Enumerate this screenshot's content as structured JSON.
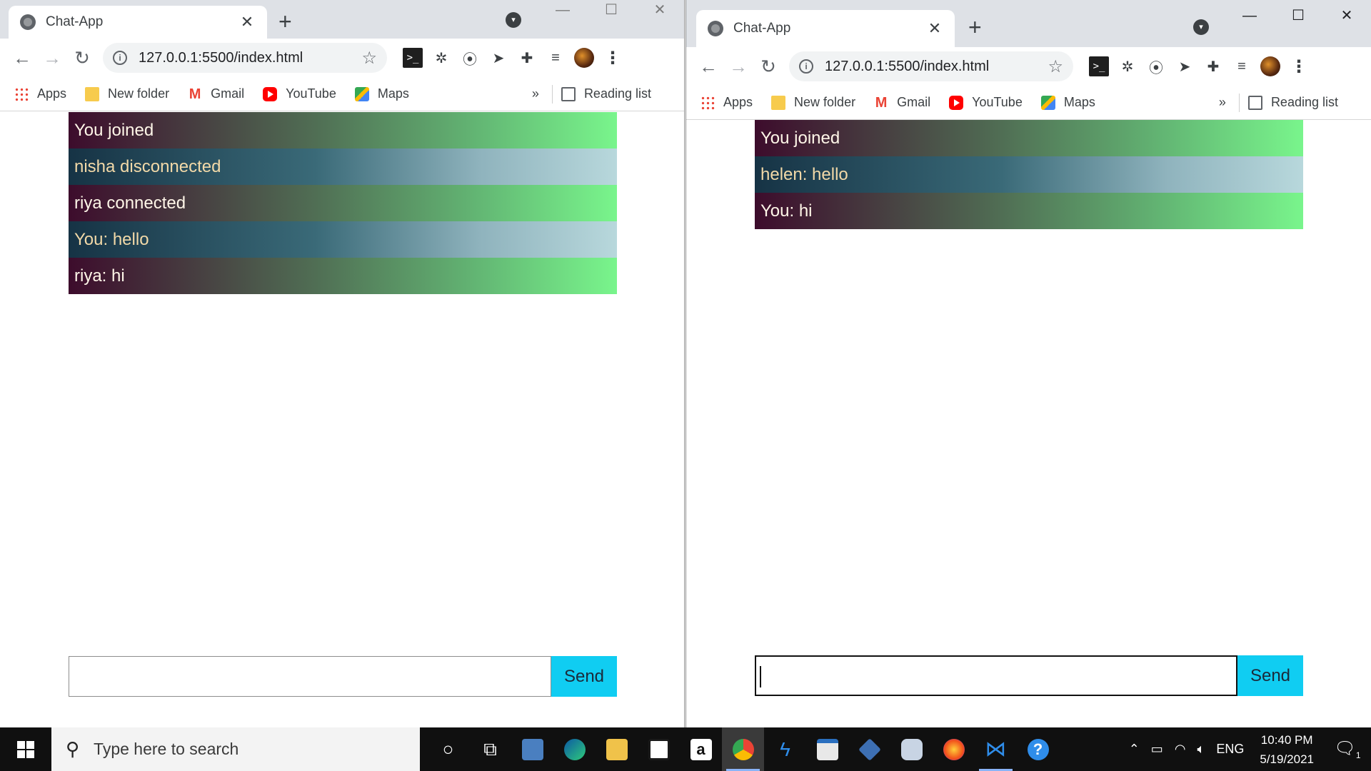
{
  "browser": {
    "tab_title": "Chat-App",
    "tab_close": "✕",
    "new_tab": "+",
    "url": "127.0.0.1:5500/index.html",
    "bookmarks": [
      "Apps",
      "New folder",
      "Gmail",
      "YouTube",
      "Maps"
    ],
    "bookmarks_more": "»",
    "reading_list": "Reading list"
  },
  "left_window": {
    "messages": [
      {
        "text": "You joined",
        "style": "g"
      },
      {
        "text": "nisha disconnected",
        "style": "b"
      },
      {
        "text": "riya connected",
        "style": "g"
      },
      {
        "text": "You: hello",
        "style": "b"
      },
      {
        "text": "riya: hi",
        "style": "g"
      }
    ],
    "input_value": "",
    "send_label": "Send"
  },
  "right_window": {
    "messages": [
      {
        "text": "You joined",
        "style": "g"
      },
      {
        "text": "helen: hello",
        "style": "b"
      },
      {
        "text": "You: hi",
        "style": "g"
      }
    ],
    "input_value": "",
    "send_label": "Send"
  },
  "taskbar": {
    "search_placeholder": "Type here to search",
    "language": "ENG",
    "time": "10:40 PM",
    "date": "5/19/2021",
    "notification_count": "1"
  },
  "colors": {
    "send_button": "#10cdf2",
    "msg_green_end": "#79f58c",
    "msg_blue_end": "#b8d8dc"
  }
}
